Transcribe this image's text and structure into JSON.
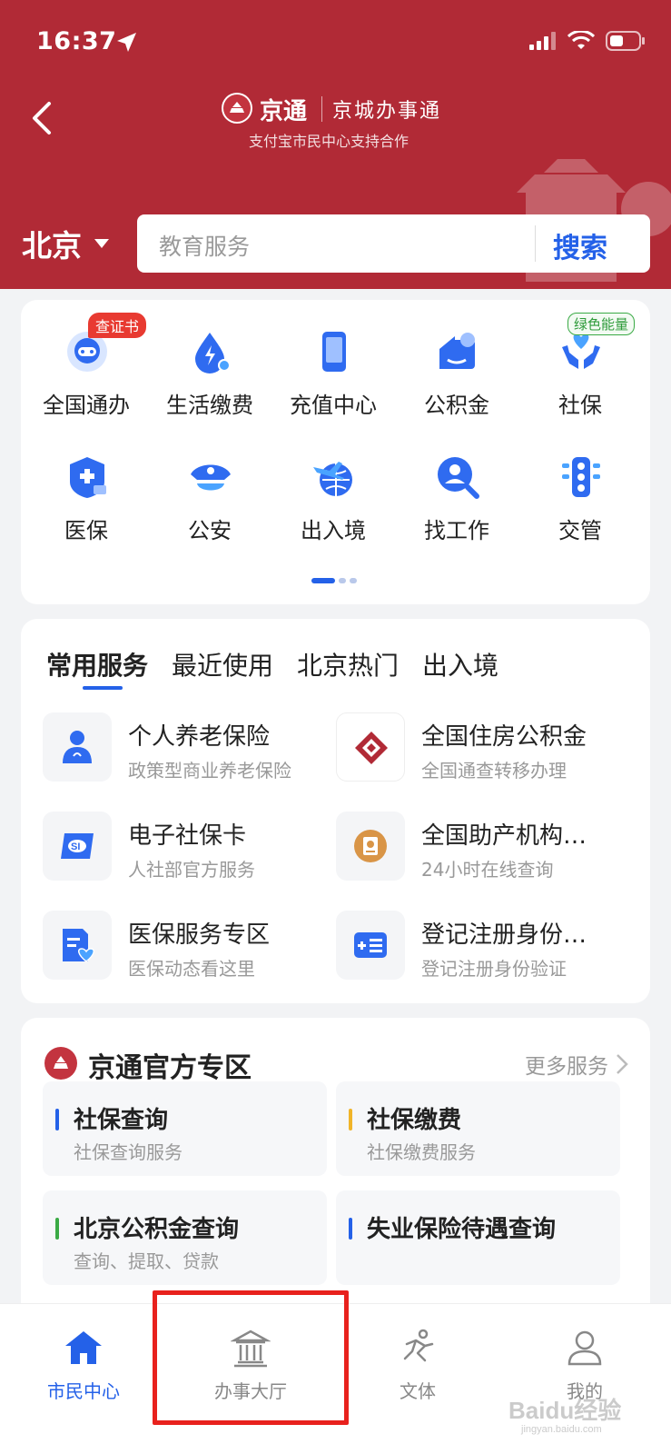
{
  "status_bar": {
    "time": "16:37"
  },
  "header": {
    "brand_name": "京通",
    "brand_slogan": "京城办事通",
    "brand_sub": "支付宝市民中心支持合作",
    "city": "北京",
    "search_placeholder": "教育服务",
    "search_button": "搜索"
  },
  "colors": {
    "header_red": "#b12a36",
    "accent_blue": "#2461e8",
    "badge_red": "#e83a31",
    "badge_green": "#3aaa45"
  },
  "grid": {
    "items": [
      {
        "label": "全国通办",
        "icon": "globe-robot-icon",
        "badge": "查证书"
      },
      {
        "label": "生活缴费",
        "icon": "water-drop-bolt-icon"
      },
      {
        "label": "充值中心",
        "icon": "phone-icon"
      },
      {
        "label": "公积金",
        "icon": "house-yuan-icon"
      },
      {
        "label": "社保",
        "icon": "hands-heart-icon",
        "badge": "绿色能量"
      },
      {
        "label": "医保",
        "icon": "medical-shield-icon"
      },
      {
        "label": "公安",
        "icon": "police-cap-icon"
      },
      {
        "label": "出入境",
        "icon": "plane-globe-icon"
      },
      {
        "label": "找工作",
        "icon": "person-search-icon"
      },
      {
        "label": "交管",
        "icon": "traffic-light-icon"
      }
    ],
    "page_count": 3,
    "active_page": 1
  },
  "services": {
    "tabs": [
      "常用服务",
      "最近使用",
      "北京热门",
      "出入境"
    ],
    "active_tab": 0,
    "items": [
      {
        "title": "个人养老保险",
        "subtitle": "政策型商业养老保险",
        "icon": "pension-person-icon"
      },
      {
        "title": "全国住房公积金",
        "subtitle": "全国通查转移办理",
        "icon": "housing-fund-logo-icon"
      },
      {
        "title": "电子社保卡",
        "subtitle": "人社部官方服务",
        "icon": "social-security-card-icon"
      },
      {
        "title": "全国助产机构…",
        "subtitle": "24小时在线查询",
        "icon": "maternity-clinic-icon"
      },
      {
        "title": "医保服务专区",
        "subtitle": "医保动态看这里",
        "icon": "medical-document-heart-icon"
      },
      {
        "title": "登记注册身份…",
        "subtitle": "登记注册身份验证",
        "icon": "id-card-icon"
      }
    ]
  },
  "zone": {
    "title": "京通官方专区",
    "more": "更多服务",
    "tiles": [
      {
        "title": "社保查询",
        "subtitle": "社保查询服务",
        "color": "#2461e8"
      },
      {
        "title": "社保缴费",
        "subtitle": "社保缴费服务",
        "color": "#f0b429"
      },
      {
        "title": "北京公积金查询",
        "subtitle": "查询、提取、贷款",
        "color": "#3aaa45"
      },
      {
        "title": "失业保险待遇查询",
        "subtitle": "",
        "color": "#2461e8"
      }
    ]
  },
  "tabbar": {
    "items": [
      {
        "label": "市民中心",
        "icon": "home-icon",
        "active": true
      },
      {
        "label": "办事大厅",
        "icon": "government-hall-icon",
        "active": false
      },
      {
        "label": "文体",
        "icon": "running-person-icon",
        "active": false
      },
      {
        "label": "我的",
        "icon": "user-icon",
        "active": false
      }
    ]
  },
  "watermark": "Baidu经验"
}
